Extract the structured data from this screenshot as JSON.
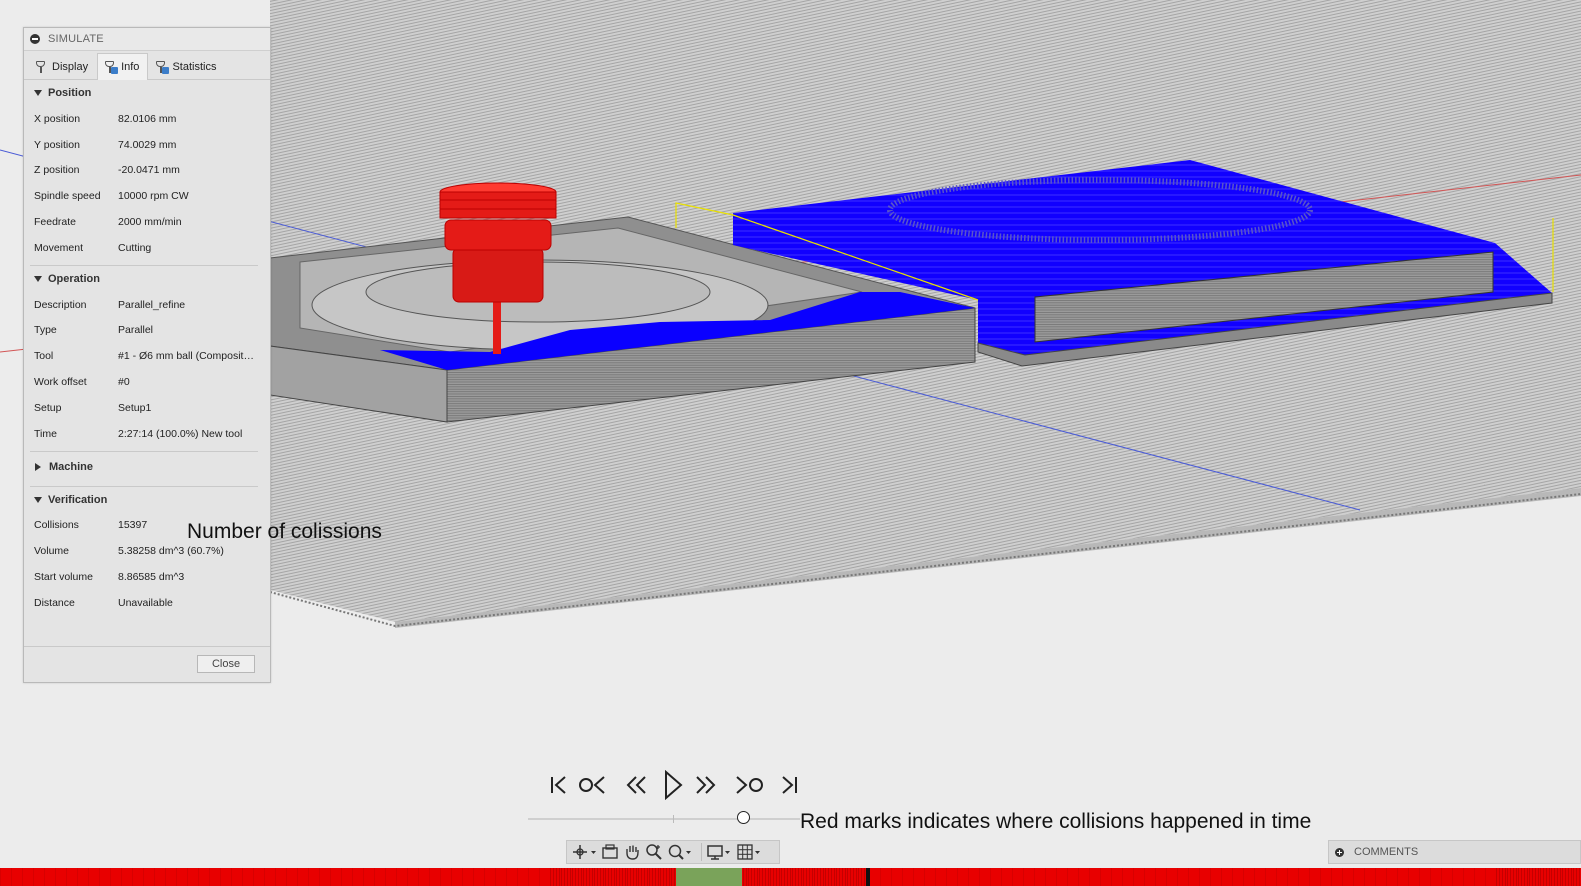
{
  "panel": {
    "title": "SIMULATE",
    "tabs": [
      {
        "label": "Display",
        "icon": "tool-icon",
        "active": false
      },
      {
        "label": "Info",
        "icon": "tool-info-icon",
        "active": true
      },
      {
        "label": "Statistics",
        "icon": "tool-stats-icon",
        "active": false
      }
    ],
    "position": {
      "header": "Position",
      "rows": [
        {
          "key": "X position",
          "value": "82.0106 mm"
        },
        {
          "key": "Y position",
          "value": "74.0029 mm"
        },
        {
          "key": "Z position",
          "value": "-20.0471 mm"
        },
        {
          "key": "Spindle speed",
          "value": "10000 rpm CW"
        },
        {
          "key": "Feedrate",
          "value": "2000 mm/min"
        },
        {
          "key": "Movement",
          "value": "Cutting"
        }
      ]
    },
    "operation": {
      "header": "Operation",
      "rows": [
        {
          "key": "Description",
          "value": "Parallel_refine"
        },
        {
          "key": "Type",
          "value": "Parallel"
        },
        {
          "key": "Tool",
          "value": "#1 - Ø6 mm ball (Composite..."
        },
        {
          "key": "Work offset",
          "value": "#0"
        },
        {
          "key": "Setup",
          "value": "Setup1"
        },
        {
          "key": "Time",
          "value": "2:27:14 (100.0%) New tool"
        }
      ]
    },
    "machine": {
      "header": "Machine"
    },
    "verification": {
      "header": "Verification",
      "rows": [
        {
          "key": "Collisions",
          "value": "15397"
        },
        {
          "key": "Volume",
          "value": "5.38258 dm^3 (60.7%)"
        },
        {
          "key": "Start volume",
          "value": "8.86585 dm^3"
        },
        {
          "key": "Distance",
          "value": "Unavailable"
        }
      ]
    },
    "close_label": "Close"
  },
  "annotations": {
    "collisions": "Number of colissions",
    "timeline": "Red marks indicates where collisions happened in time"
  },
  "playback": {
    "buttons": [
      "go-to-start-icon",
      "previous-operation-icon",
      "step-back-icon",
      "play-icon",
      "step-forward-icon",
      "next-operation-icon",
      "go-to-end-icon"
    ],
    "progress": 0.79
  },
  "navbar": {
    "buttons": [
      "orbit-icon",
      "look-at-icon",
      "pan-icon",
      "zoom-icon",
      "fit-icon",
      "display-settings-icon",
      "grid-icon"
    ]
  },
  "comments": {
    "label": "COMMENTS"
  },
  "colors": {
    "tool": "#e41b17",
    "material": "#0a00ff",
    "stock": "#8c8c8c",
    "collision_mark": "#e80000",
    "timeline_highlight": "#7aa35a"
  }
}
